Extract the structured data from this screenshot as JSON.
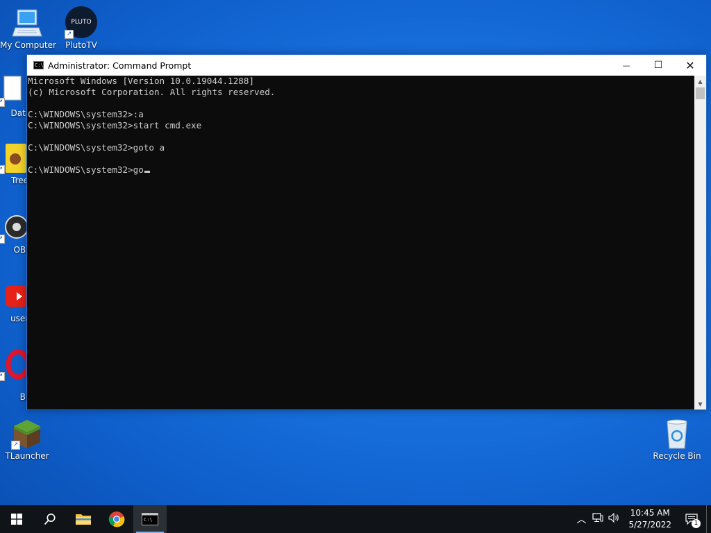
{
  "desktop": {
    "icons": [
      {
        "label": "My Computer"
      },
      {
        "label": "PlutoTV",
        "badge": "PLUTO"
      },
      {
        "label": "DataW"
      },
      {
        "label": "Treeho"
      },
      {
        "label": "OBS S"
      },
      {
        "label": "userna"
      },
      {
        "label": "Op"
      },
      {
        "label": "Brov"
      },
      {
        "label": "TLauncher"
      },
      {
        "label": "Recycle Bin"
      }
    ]
  },
  "window": {
    "title": "Administrator: Command Prompt",
    "controls": {
      "minimize": "—",
      "maximize": "☐",
      "close": "✕"
    },
    "console_lines": [
      "Microsoft Windows [Version 10.0.19044.1288]",
      "(c) Microsoft Corporation. All rights reserved.",
      "",
      "C:\\WINDOWS\\system32>:a",
      "C:\\WINDOWS\\system32>start cmd.exe",
      "",
      "C:\\WINDOWS\\system32>goto a",
      "",
      "C:\\WINDOWS\\system32>go"
    ]
  },
  "taskbar": {
    "clock_time": "10:45 AM",
    "clock_date": "5/27/2022",
    "notification_count": "1"
  },
  "colors": {
    "console_bg": "#0c0c0c",
    "console_text": "#cccccc",
    "taskbar_bg": "#101418"
  }
}
